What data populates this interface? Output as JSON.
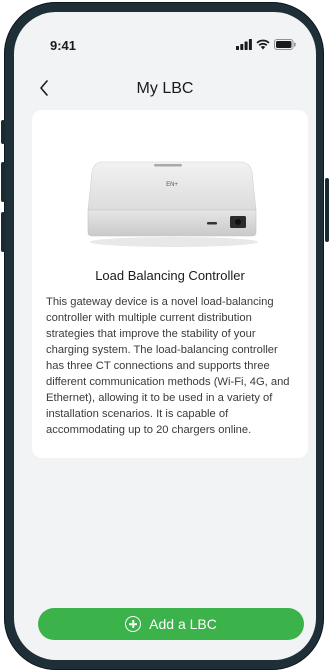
{
  "status_bar": {
    "time": "9:41",
    "icons": [
      "signal-icon",
      "wifi-icon",
      "battery-icon"
    ]
  },
  "nav": {
    "back_icon": "chevron-left-icon",
    "title": "My LBC"
  },
  "device": {
    "image": "gateway-device-image",
    "logo_text": "EN+",
    "title": "Load Balancing Controller",
    "description": "This gateway device is a novel load-balancing controller with multiple current distribution strategies that improve the stability of your charging system. The load-balancing controller has three CT connections and supports three different communication methods (Wi-Fi, 4G, and Ethernet), allowing it to be used in a variety of installation scenarios. It is capable of accommodating up to 20 chargers online."
  },
  "action": {
    "add_label": "Add a LBC",
    "add_icon": "plus-circle-icon"
  },
  "colors": {
    "background": "#f2f3f5",
    "card": "#ffffff",
    "primary": "#3bb24a",
    "frame": "#1f2f37"
  }
}
